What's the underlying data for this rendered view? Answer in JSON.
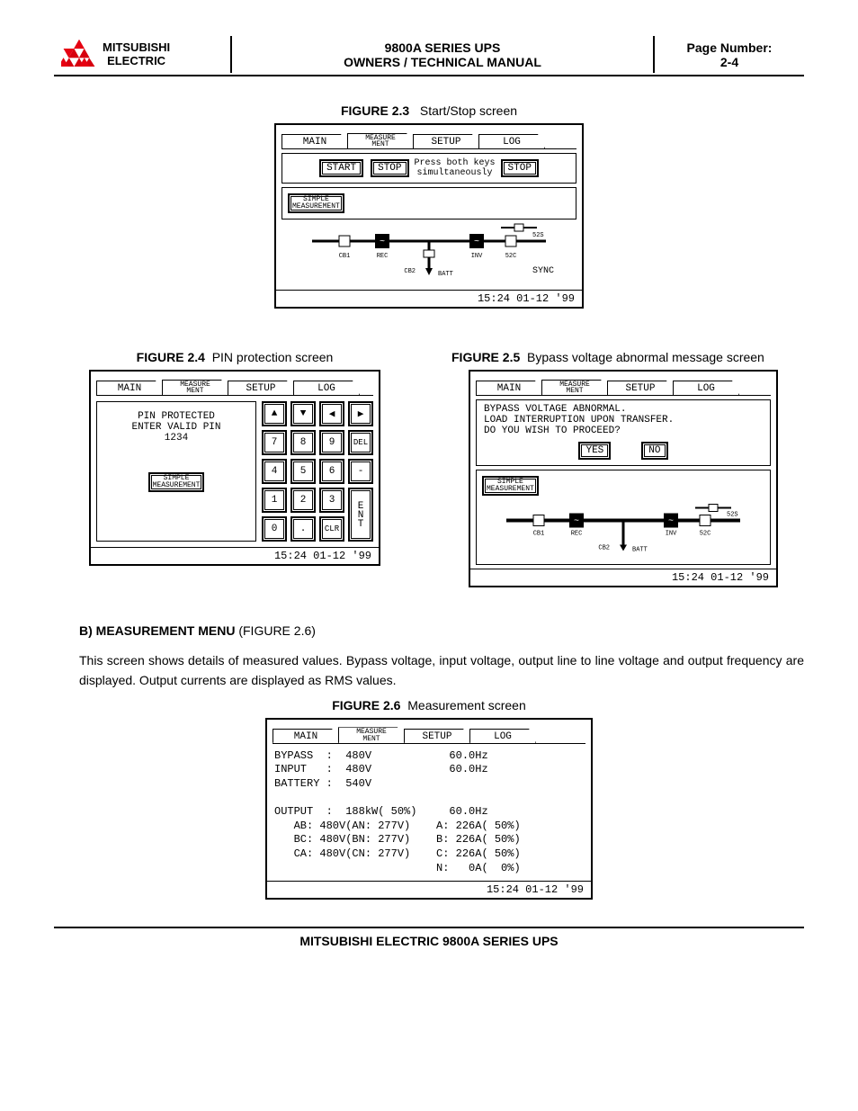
{
  "header": {
    "brand1": "MITSUBISHI",
    "brand2": "ELECTRIC",
    "title1": "9800A SERIES UPS",
    "title2": "OWNERS / TECHNICAL MANUAL",
    "page_label": "Page Number:",
    "page_num": "2-4"
  },
  "fig23": {
    "num": "FIGURE 2.3",
    "caption": "Start/Stop screen",
    "tabs": [
      "MAIN",
      "MEASURE\nMENT",
      "SETUP",
      "LOG"
    ],
    "btn_start": "START",
    "btn_stop": "STOP",
    "note": "Press both keys\nsimultaneously",
    "btn_stop2": "STOP",
    "btn_simple": "SIMPLE\nMEASUREMENT",
    "diag": {
      "cb1": "CB1",
      "rec": "REC",
      "cb2": "CB2",
      "batt": "BATT",
      "inv": "INV",
      "s52s": "52S",
      "s52c": "52C",
      "sync": "SYNC."
    },
    "status": "15:24 01-12 '99"
  },
  "fig24": {
    "num": "FIGURE 2.4",
    "caption": "PIN protection screen",
    "tabs": [
      "MAIN",
      "MEASURE\nMENT",
      "SETUP",
      "LOG"
    ],
    "msg1": "PIN PROTECTED",
    "msg2": "ENTER VALID PIN",
    "msg3": "1234",
    "btn_simple": "SIMPLE\nMEASUREMENT",
    "keys": [
      "▲",
      "▼",
      "◀",
      "▶",
      "7",
      "8",
      "9",
      "DEL",
      "4",
      "5",
      "6",
      "-",
      "1",
      "2",
      "3",
      "0",
      ".",
      "CLR"
    ],
    "key_ent": "ENT",
    "status": "15:24 01-12 '99"
  },
  "fig25": {
    "num": "FIGURE 2.5",
    "caption": "Bypass voltage abnormal message screen",
    "tabs": [
      "MAIN",
      "MEASURE\nMENT",
      "SETUP",
      "LOG"
    ],
    "line1": "BYPASS VOLTAGE ABNORMAL.",
    "line2": "LOAD INTERRUPTION UPON TRANSFER.",
    "line3": "DO YOU WISH TO PROCEED?",
    "yes": "YES",
    "no": "NO",
    "btn_simple": "SIMPLE\nMEASUREMENT",
    "diag": {
      "cb1": "CB1",
      "rec": "REC",
      "cb2": "CB2",
      "batt": "BATT",
      "inv": "INV",
      "s52s": "52S",
      "s52c": "52C"
    },
    "status": "15:24 01-12 '99"
  },
  "section_b": {
    "head": "B)   MEASUREMENT MENU",
    "head_ref": "(FIGURE 2.6)",
    "body": "This screen shows details of measured values. Bypass voltage, input voltage, output line to line voltage and output frequency are displayed. Output currents are displayed as RMS values."
  },
  "fig26": {
    "num": "FIGURE 2.6",
    "caption": "Measurement screen",
    "tabs": [
      "MAIN",
      "MEASURE\nMENT",
      "SETUP",
      "LOG"
    ],
    "lines": "BYPASS  :  480V            60.0Hz\nINPUT   :  480V            60.0Hz\nBATTERY :  540V\n\nOUTPUT  :  188kW( 50%)     60.0Hz\n   AB: 480V(AN: 277V)    A: 226A( 50%)\n   BC: 480V(BN: 277V)    B: 226A( 50%)\n   CA: 480V(CN: 277V)    C: 226A( 50%)\n                         N:   0A(  0%)",
    "status": "15:24 01-12 '99"
  },
  "footer": "MITSUBISHI ELECTRIC 9800A SERIES UPS",
  "chart_data": {
    "type": "table",
    "title": "Measurement screen values",
    "rows": [
      {
        "label": "BYPASS",
        "voltage": "480V",
        "freq": "60.0Hz"
      },
      {
        "label": "INPUT",
        "voltage": "480V",
        "freq": "60.0Hz"
      },
      {
        "label": "BATTERY",
        "voltage": "540V"
      },
      {
        "label": "OUTPUT",
        "power": "188kW",
        "load_pct": "50%",
        "freq": "60.0Hz"
      },
      {
        "label": "AB",
        "ll_v": "480V",
        "ln_label": "AN",
        "ln_v": "277V",
        "phase": "A",
        "current": "226A",
        "pct": "50%"
      },
      {
        "label": "BC",
        "ll_v": "480V",
        "ln_label": "BN",
        "ln_v": "277V",
        "phase": "B",
        "current": "226A",
        "pct": "50%"
      },
      {
        "label": "CA",
        "ll_v": "480V",
        "ln_label": "CN",
        "ln_v": "277V",
        "phase": "C",
        "current": "226A",
        "pct": "50%"
      },
      {
        "phase": "N",
        "current": "0A",
        "pct": "0%"
      }
    ]
  }
}
